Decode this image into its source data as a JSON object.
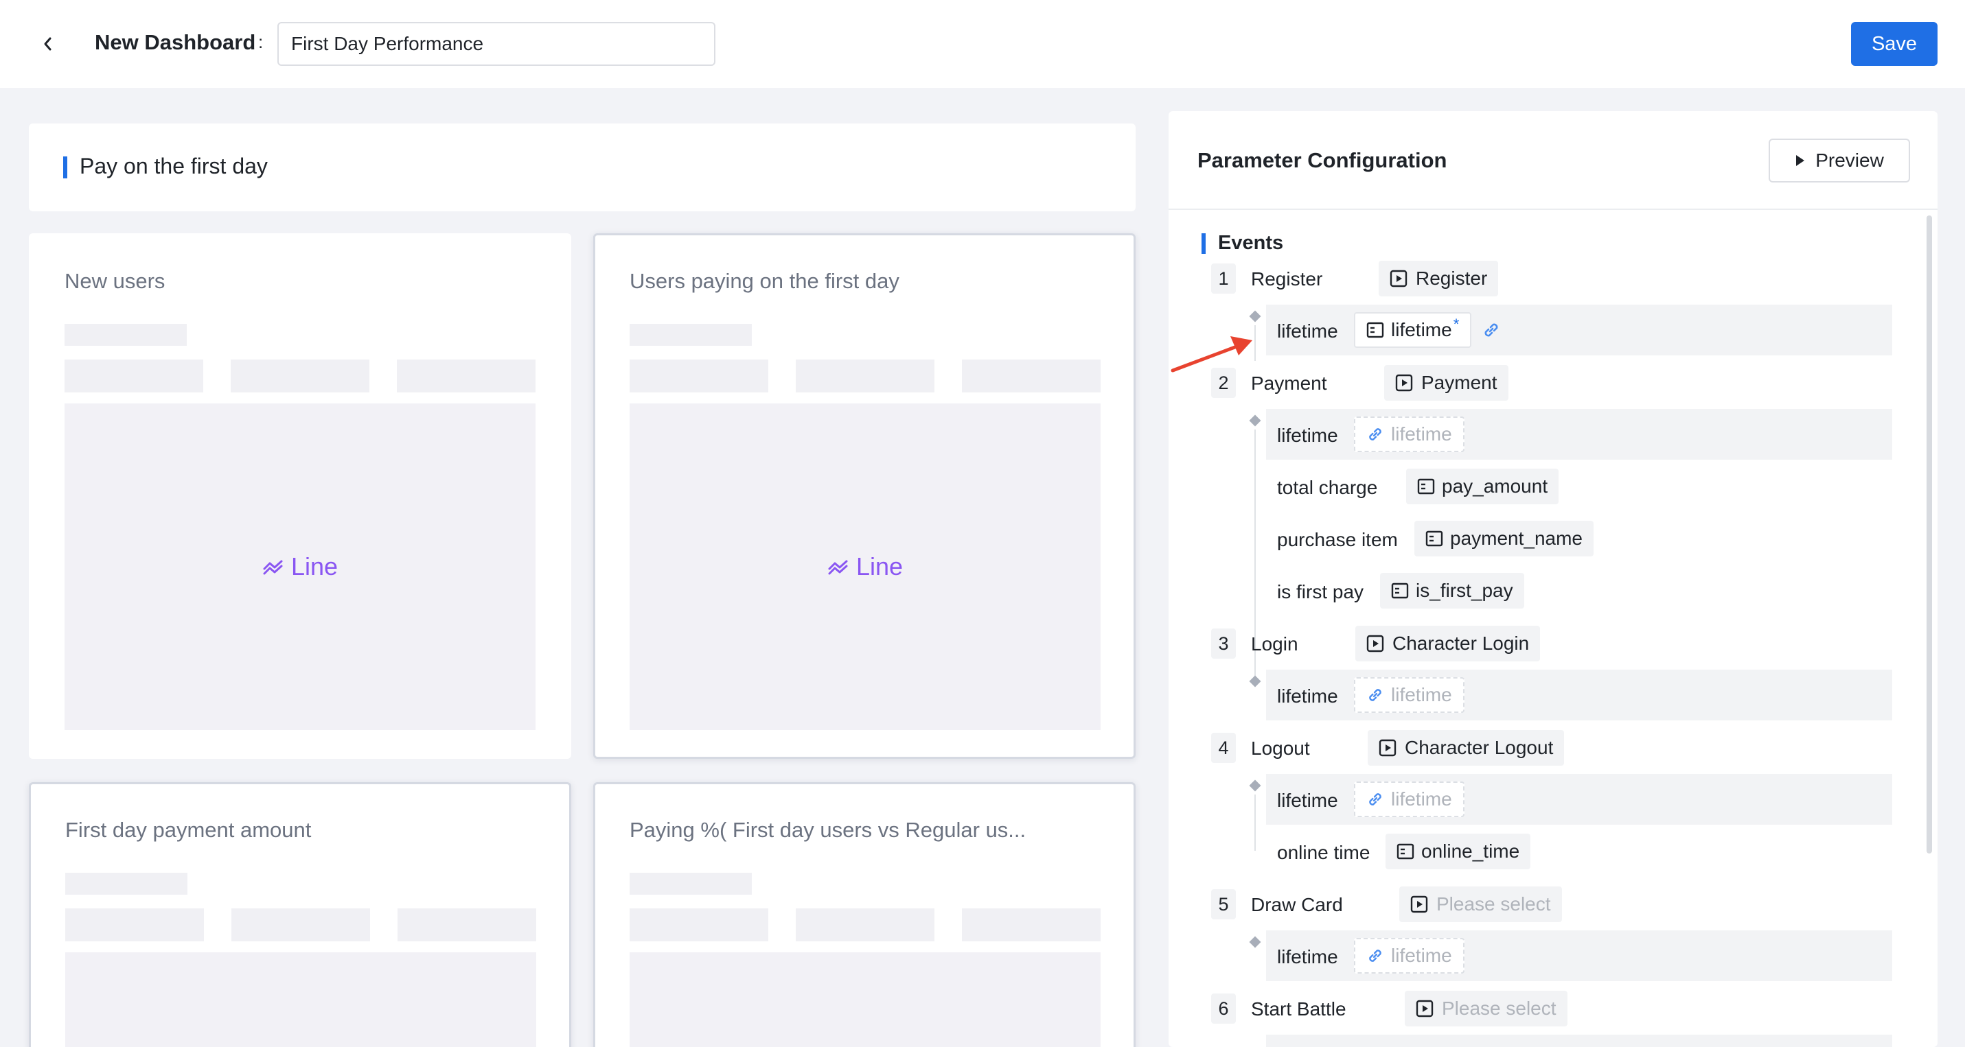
{
  "header": {
    "title": "New Dashboard",
    "colon": ":",
    "name_value": "First Day Performance",
    "save_label": "Save"
  },
  "section": {
    "title": "Pay on the first day"
  },
  "cards": [
    {
      "title": "New users",
      "chart_label": "Line"
    },
    {
      "title": "Users paying on the first day",
      "chart_label": "Line"
    },
    {
      "title": "First day payment amount"
    },
    {
      "title": "Paying %( First day users vs Regular us..."
    }
  ],
  "panel": {
    "title": "Parameter Configuration",
    "preview_label": "Preview",
    "events_title": "Events",
    "events": [
      {
        "num": "1",
        "label": "Register",
        "event": "Register",
        "props": [
          {
            "label": "lifetime",
            "value": "lifetime",
            "required": "*"
          }
        ]
      },
      {
        "num": "2",
        "label": "Payment",
        "event": "Payment",
        "props": [
          {
            "label": "lifetime",
            "value": "lifetime"
          },
          {
            "label": "total charge",
            "value": "pay_amount"
          },
          {
            "label": "purchase item",
            "value": "payment_name"
          },
          {
            "label": "is first pay",
            "value": "is_first_pay"
          }
        ]
      },
      {
        "num": "3",
        "label": "Login",
        "event": "Character Login",
        "props": [
          {
            "label": "lifetime",
            "value": "lifetime"
          }
        ]
      },
      {
        "num": "4",
        "label": "Logout",
        "event": "Character Logout",
        "props": [
          {
            "label": "lifetime",
            "value": "lifetime"
          },
          {
            "label": "online time",
            "value": "online_time"
          }
        ]
      },
      {
        "num": "5",
        "label": "Draw Card",
        "event": "Please select",
        "props": [
          {
            "label": "lifetime",
            "value": "lifetime"
          }
        ]
      },
      {
        "num": "6",
        "label": "Start Battle",
        "event": "Please select"
      }
    ]
  },
  "colors": {
    "accent": "#1f6fe5",
    "chart_label": "#8a56f2",
    "annotation_arrow": "#e8432f"
  }
}
